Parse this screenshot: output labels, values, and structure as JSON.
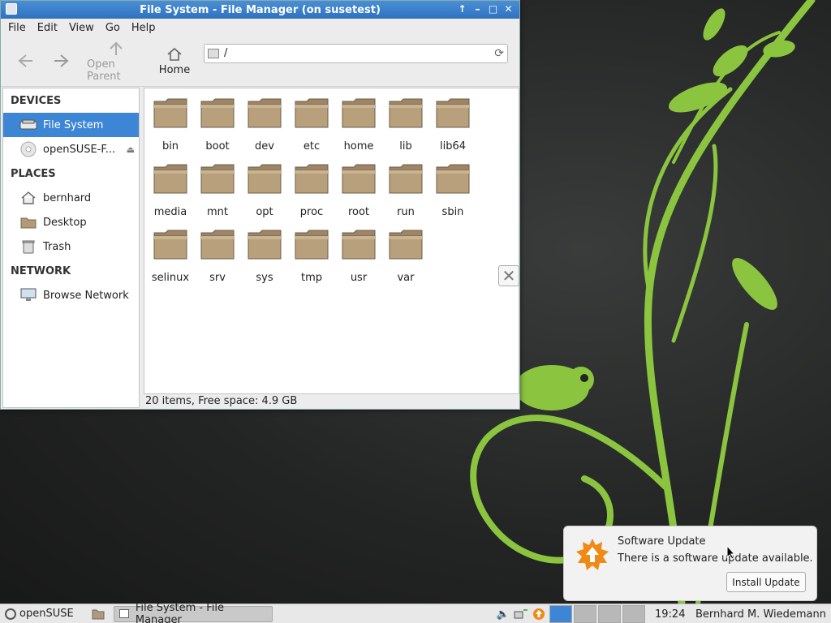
{
  "window": {
    "title": "File System - File Manager (on susetest)",
    "controls": [
      "↑",
      "–",
      "□",
      "✕"
    ]
  },
  "menu": [
    "File",
    "Edit",
    "View",
    "Go",
    "Help"
  ],
  "toolbar": {
    "open_parent": "Open Parent",
    "home": "Home",
    "address": "/"
  },
  "sidebar": {
    "devices_header": "DEVICES",
    "places_header": "PLACES",
    "network_header": "NETWORK",
    "devices": [
      {
        "label": "File System",
        "icon": "drive-icon",
        "selected": true
      },
      {
        "label": "openSUSE-F...",
        "icon": "disc-icon",
        "selected": false
      }
    ],
    "places": [
      {
        "label": "bernhard",
        "icon": "home-folder-icon"
      },
      {
        "label": "Desktop",
        "icon": "desktop-folder-icon"
      },
      {
        "label": "Trash",
        "icon": "trash-icon"
      }
    ],
    "network": [
      {
        "label": "Browse Network",
        "icon": "network-icon"
      }
    ]
  },
  "files": [
    "bin",
    "boot",
    "dev",
    "etc",
    "home",
    "lib",
    "lib64",
    "media",
    "mnt",
    "opt",
    "proc",
    "root",
    "run",
    "sbin",
    "selinux",
    "srv",
    "sys",
    "tmp",
    "usr",
    "var"
  ],
  "status_bar": "20 items, Free space: 4.9 GB",
  "notification": {
    "title": "Software Update",
    "body": "There is a software update available.",
    "button": "Install Update"
  },
  "taskbar": {
    "start_label": "openSUSE",
    "task_label": "File System - File Manager",
    "clock": "19:24",
    "user": "Bernhard M. Wiedemann"
  },
  "colors": {
    "accent": "#3d86d6",
    "titlebar": "#2f71c0",
    "folder": "#b29a78",
    "wallpaper_plant": "#8bc53f"
  }
}
